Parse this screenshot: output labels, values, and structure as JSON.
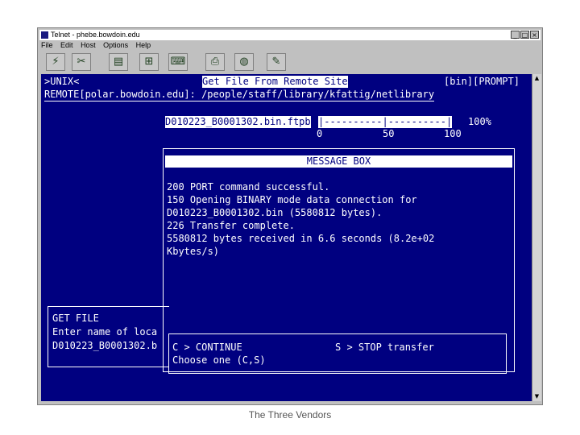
{
  "window": {
    "title": "Telnet - phebe.bowdoin.edu",
    "controls": [
      "_",
      "□",
      "×"
    ]
  },
  "menu": [
    "File",
    "Edit",
    "Host",
    "Options",
    "Help"
  ],
  "toolbar": [
    {
      "icon": "connect-icon",
      "glyph": "⚡"
    },
    {
      "icon": "disconnect-icon",
      "glyph": "✂"
    },
    {
      "icon": "doc-icon",
      "glyph": "▤"
    },
    {
      "icon": "sliders-icon",
      "glyph": "⊞"
    },
    {
      "icon": "keyboard-icon",
      "glyph": "⌨"
    },
    {
      "icon": "printer-icon",
      "glyph": "⎙"
    },
    {
      "icon": "globe-icon",
      "glyph": "◍"
    },
    {
      "icon": "tool-icon",
      "glyph": "✎"
    }
  ],
  "terminal": {
    "prompt": ">UNIX<",
    "header_title": "Get File From Remote Site",
    "mode": "[bin][PROMPT]",
    "remote_path": "REMOTE[polar.bowdoin.edu]: /people/staff/library/kfattig/netlibrary",
    "progress": {
      "filename": "D010223_B0001302.bin.ftpb",
      "bar": "|----------|----------|",
      "percent_label": "100%",
      "percent": 100,
      "ticks": [
        "0",
        "50",
        "100"
      ]
    },
    "message_box": {
      "title": "MESSAGE BOX",
      "lines": [
        "200 PORT command successful.",
        "150 Opening BINARY mode data connection for",
        "D010223_B0001302.bin (5580812 bytes).",
        "226 Transfer complete.",
        "5580812 bytes received in 6.6 seconds (8.2e+02",
        "Kbytes/s)"
      ]
    },
    "get_file": {
      "title": "GET FILE",
      "prompt": "Enter name of loca",
      "value": "D010223_B0001302.b"
    },
    "choice": {
      "continue": "C > CONTINUE",
      "stop": "S > STOP transfer",
      "prompt": "Choose one (C,S)"
    }
  },
  "caption": "The Three Vendors"
}
